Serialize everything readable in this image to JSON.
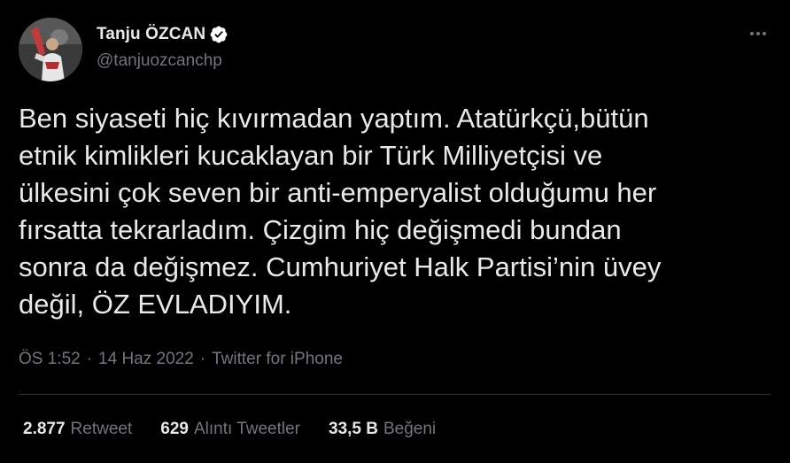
{
  "author": {
    "display_name": "Tanju ÖZCAN",
    "handle": "@tanjuozcanchp",
    "verified": true,
    "avatar_icon": "user-avatar-photo"
  },
  "tweet": {
    "text": "Ben siyaseti hiç kıvırmadan yaptım. Atatürkçü,bütün\netnik kimlikleri kucaklayan bir Türk Milliyetçisi ve\nülkesini çok seven bir anti-emperyalist olduğumu her\nfırsatta tekrarladım. Çizgim hiç değişmedi bundan\nsonra da değişmez. Cumhuriyet Halk Partisi’nin üvey\ndeğil, ÖZ EVLADIYIM."
  },
  "meta": {
    "time": "ÖS 1:52",
    "separator": "·",
    "date": "14 Haz 2022",
    "source": "Twitter for iPhone"
  },
  "stats": [
    {
      "count": "2.877",
      "label": "Retweet"
    },
    {
      "count": "629",
      "label": "Alıntı Tweetler"
    },
    {
      "count": "33,5 B",
      "label": "Beğeni"
    }
  ],
  "colors": {
    "background": "#000000",
    "text": "#e7e9ea",
    "muted": "#71767b",
    "divider": "#2f3336",
    "verified_badge": "#ffffff"
  },
  "icons": {
    "more": "more-horizontal-icon",
    "verified": "verified-badge-icon"
  }
}
